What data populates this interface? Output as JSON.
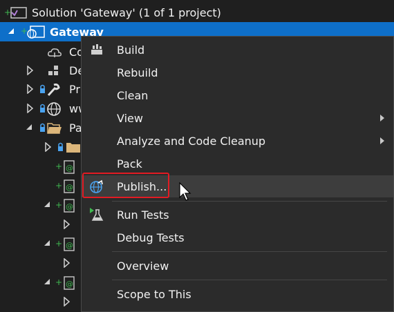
{
  "tree": {
    "solution_label": "Solution 'Gateway' (1 of 1 project)",
    "project_label": "Gateway",
    "items": [
      {
        "label": "Co",
        "icon": "cloud-connected-services-icon"
      },
      {
        "label": "De",
        "icon": "dependencies-icon"
      },
      {
        "label": "Pr",
        "icon": "properties-wrench-icon"
      },
      {
        "label": "ww",
        "icon": "globe-wwwroot-icon"
      },
      {
        "label": "Pa",
        "icon": "folder-open-icon"
      }
    ]
  },
  "context_menu": {
    "build": "Build",
    "rebuild": "Rebuild",
    "clean": "Clean",
    "view": "View",
    "analyze": "Analyze and Code Cleanup",
    "pack": "Pack",
    "publish": "Publish...",
    "run_tests": "Run Tests",
    "debug_tests": "Debug Tests",
    "overview": "Overview",
    "scope": "Scope to This"
  },
  "colors": {
    "background": "#1f1f1f",
    "selection": "#0e6fc9",
    "menu_background": "#2b2b2b",
    "highlight_box": "#e31b23",
    "hover": "#3d3d3d"
  }
}
